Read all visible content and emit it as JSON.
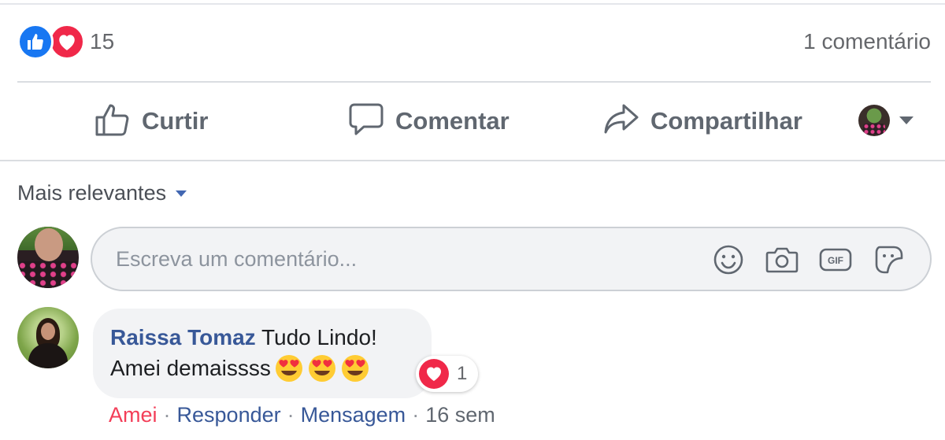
{
  "reactions": {
    "count": "15",
    "types": [
      "like-icon",
      "love-icon"
    ],
    "comments_count_label": "1 comentário"
  },
  "actions": {
    "like_label": "Curtir",
    "comment_label": "Comentar",
    "share_label": "Compartilhar"
  },
  "sort": {
    "label": "Mais relevantes"
  },
  "composer": {
    "placeholder": "Escreva um comentário...",
    "tools": [
      "emoji-icon",
      "camera-icon",
      "gif-icon",
      "sticker-icon"
    ]
  },
  "comment": {
    "author": "Raissa Tomaz",
    "text_line1": "Tudo Lindo!",
    "text_line2": "Amei demaissss",
    "emojis": [
      "heart-eyes",
      "heart-eyes",
      "heart-eyes"
    ],
    "reaction_count": "1",
    "reaction_type": "love-icon",
    "action_amei": "Amei",
    "action_responder": "Responder",
    "action_mensagem": "Mensagem",
    "time": "16 sem",
    "separator": "·"
  },
  "colors": {
    "like_blue": "#1877f2",
    "love_red": "#f02849",
    "author_blue": "#385898",
    "amei_red": "#f33e58",
    "bubble_bg": "#f2f3f5"
  }
}
